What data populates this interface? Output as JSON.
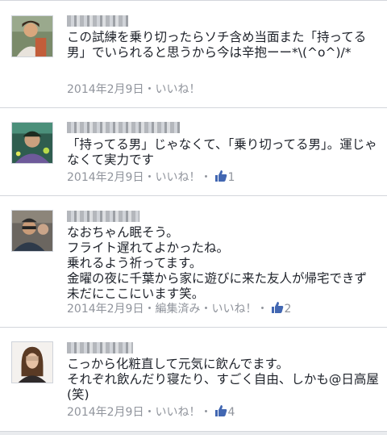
{
  "comments": [
    {
      "text": "この試練を乗り切ったらソチ含め当面また「持ってる男」でいられると思うから今は辛抱ーー*\\(^o^)/*",
      "date": "2014年2月9日",
      "sep": "・",
      "like_label": "いいね！",
      "edited_label": "",
      "like_count": ""
    },
    {
      "text": "「持ってる男」じゃなくて、「乗り切ってる男」。運じゃなくて実力です",
      "date": "2014年2月9日",
      "sep": "・",
      "like_label": "いいね！",
      "edited_label": "",
      "like_count": "1"
    },
    {
      "text": "なおちゃん眠そう。\nフライト遅れてよかったね。\n乗れるよう祈ってます。\n金曜の夜に千葉から家に遊びに来た友人が帰宅できず未だにここにいます笑。",
      "date": "2014年2月9日",
      "sep": "・",
      "like_label": "いいね！",
      "edited_label": "編集済み",
      "like_count": "2"
    },
    {
      "text": "こっから化粧直して元気に飲んでます。\nそれぞれ飲んだり寝たり、すごく自由、しかも@日高屋(笑)",
      "date": "2014年2月9日",
      "sep": "・",
      "like_label": "いいね！",
      "edited_label": "",
      "like_count": "4"
    }
  ],
  "colors": {
    "meta": "#90949c",
    "like_blue": "#4267b2",
    "text": "#1d2129"
  },
  "icons": {
    "like": "thumbs-up-icon"
  }
}
